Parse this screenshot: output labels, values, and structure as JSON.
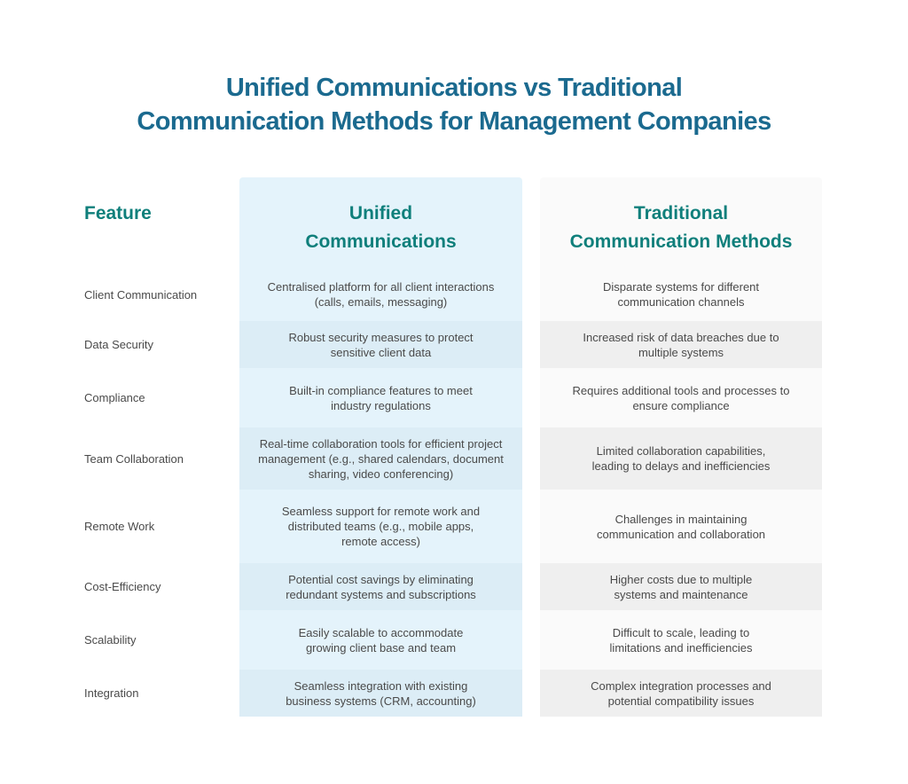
{
  "title_line1": "Unified Communications vs Traditional",
  "title_line2": "Communication Methods for Management Companies",
  "headers": {
    "feature": "Feature",
    "unified_line1": "Unified",
    "unified_line2": "Communications",
    "traditional_line1": "Traditional",
    "traditional_line2": "Communication Methods"
  },
  "colors": {
    "title": "#1b6a8f",
    "header": "#0f7f7b",
    "unified_bg": "#e4f3fb",
    "unified_alt_bg": "#dcedf6",
    "traditional_bg": "#fafafa",
    "traditional_alt_bg": "#efefef",
    "body_text": "#4a4a4a"
  },
  "rows": [
    {
      "feature": "Client Communication",
      "unified": "Centralised platform for all client interactions (calls, emails, messaging)",
      "traditional": "Disparate systems for different communication channels"
    },
    {
      "feature": "Data Security",
      "unified": "Robust security measures to protect sensitive client data",
      "traditional": "Increased risk of data breaches due to multiple systems"
    },
    {
      "feature": "Compliance",
      "unified": "Built-in compliance features to meet industry regulations",
      "traditional": "Requires additional tools and processes to ensure compliance"
    },
    {
      "feature": "Team Collaboration",
      "unified": "Real-time collaboration tools for efficient project management (e.g., shared calendars, document sharing, video conferencing)",
      "traditional": "Limited collaboration capabilities, leading to delays and inefficiencies"
    },
    {
      "feature": "Remote Work",
      "unified": "Seamless support for remote work and distributed teams (e.g., mobile apps, remote access)",
      "traditional": "Challenges in maintaining communication and collaboration"
    },
    {
      "feature": "Cost-Efficiency",
      "unified": "Potential cost savings by eliminating redundant systems and subscriptions",
      "traditional": "Higher costs due to multiple systems and maintenance"
    },
    {
      "feature": "Scalability",
      "unified": "Easily scalable to accommodate growing client base and team",
      "traditional": "Difficult to scale, leading to limitations and inefficiencies"
    },
    {
      "feature": "Integration",
      "unified": "Seamless integration with existing business systems (CRM, accounting)",
      "traditional": "Complex integration processes and potential compatibility issues"
    }
  ]
}
